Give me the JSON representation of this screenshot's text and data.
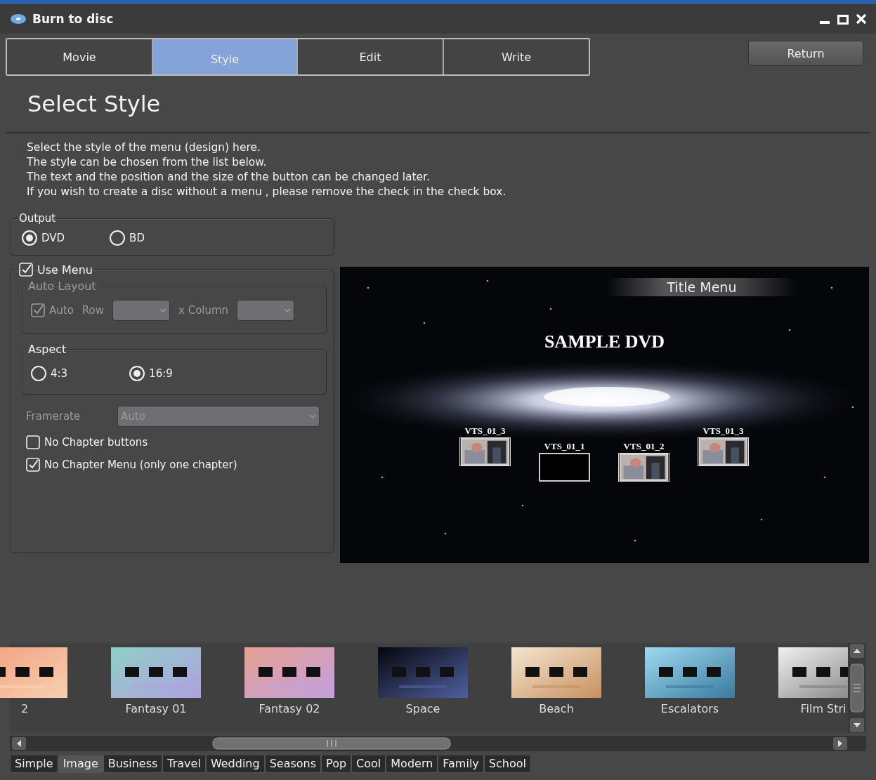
{
  "window": {
    "title": "Burn to disc"
  },
  "steps": [
    {
      "label": "Movie",
      "selected": false
    },
    {
      "label": "Style",
      "selected": true
    },
    {
      "label": "Edit",
      "selected": false
    },
    {
      "label": "Write",
      "selected": false
    }
  ],
  "return_button": "Return",
  "heading": "Select Style",
  "description": [
    "Select the style of the menu (design) here.",
    "The style can be chosen from the list below.",
    "The text and the position and the size of the button can be changed later.",
    "If you wish to create a disc without a menu , please remove the check in the check box."
  ],
  "output": {
    "legend": "Output",
    "options": [
      {
        "label": "DVD",
        "selected": true
      },
      {
        "label": "BD",
        "selected": false
      }
    ]
  },
  "use_menu": {
    "label": "Use Menu",
    "checked": true
  },
  "auto_layout": {
    "legend": "Auto Layout",
    "disabled": true,
    "auto": {
      "label": "Auto",
      "checked": true
    },
    "row_label": "Row",
    "column_label": "x  Column"
  },
  "aspect": {
    "legend": "Aspect",
    "options": [
      {
        "label": "4:3",
        "selected": false
      },
      {
        "label": "16:9",
        "selected": true
      }
    ]
  },
  "framerate": {
    "label": "Framerate",
    "value": "Auto",
    "disabled": true
  },
  "checkboxes": [
    {
      "label": "No Chapter buttons",
      "checked": false
    },
    {
      "label": "No Chapter Menu (only one chapter)",
      "checked": true
    }
  ],
  "preview": {
    "title_menu": "Title Menu",
    "disc_title": "SAMPLE DVD",
    "chapters": [
      {
        "label": "VTS_01_3",
        "kind": "picture"
      },
      {
        "label": "VTS_01_1",
        "kind": "empty"
      },
      {
        "label": "VTS_01_2",
        "kind": "picture"
      },
      {
        "label": "VTS_01_3",
        "kind": "picture"
      }
    ]
  },
  "styles": [
    {
      "name": "2",
      "kind": "picture"
    },
    {
      "name": "Fantasy 01",
      "kind": "picture"
    },
    {
      "name": "Fantasy 02",
      "kind": "picture"
    },
    {
      "name": "Space",
      "kind": "picture"
    },
    {
      "name": "Beach",
      "kind": "picture"
    },
    {
      "name": "Escalators",
      "kind": "picture"
    },
    {
      "name": "Film Stri",
      "kind": "picture"
    }
  ],
  "categories": [
    {
      "label": "Simple",
      "selected": false
    },
    {
      "label": "Image",
      "selected": true
    },
    {
      "label": "Business",
      "selected": false
    },
    {
      "label": "Travel",
      "selected": false
    },
    {
      "label": "Wedding",
      "selected": false
    },
    {
      "label": "Seasons",
      "selected": false
    },
    {
      "label": "Pop",
      "selected": false
    },
    {
      "label": "Cool",
      "selected": false
    },
    {
      "label": "Modern",
      "selected": false
    },
    {
      "label": "Family",
      "selected": false
    },
    {
      "label": "School",
      "selected": false
    }
  ]
}
